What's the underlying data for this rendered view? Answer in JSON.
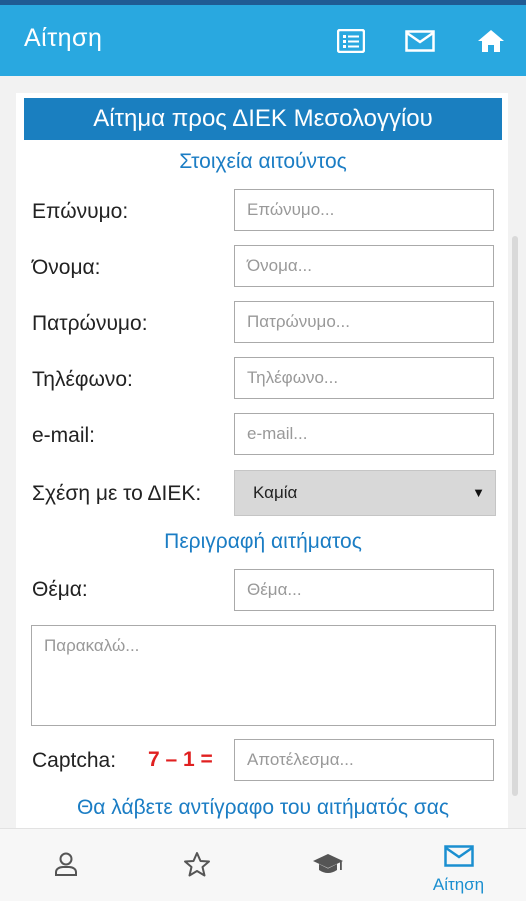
{
  "appbar": {
    "title": "Αίτηση",
    "icons": [
      "list-icon",
      "mail-icon",
      "home-icon"
    ]
  },
  "form": {
    "title": "Αίτημα προς ΔΙΕΚ Μεσολογγίου",
    "applicant_section": "Στοιχεία αιτούντος",
    "fields": [
      {
        "label": "Επώνυμο:",
        "placeholder": "Επώνυμο..."
      },
      {
        "label": "Όνομα:",
        "placeholder": "Όνομα..."
      },
      {
        "label": "Πατρώνυμο:",
        "placeholder": "Πατρώνυμο..."
      },
      {
        "label": "Τηλέφωνο:",
        "placeholder": "Τηλέφωνο..."
      },
      {
        "label": "e-mail:",
        "placeholder": "e-mail..."
      }
    ],
    "relation": {
      "label": "Σχέση με το ΔΙΕΚ:",
      "selected": "Καμία"
    },
    "request_section": "Περιγραφή αιτήματος",
    "subject": {
      "label": "Θέμα:",
      "placeholder": "Θέμα..."
    },
    "message_placeholder": "Παρακαλώ...",
    "captcha": {
      "label": "Captcha:",
      "equation": "7 – 1 =",
      "placeholder": "Αποτέλεσμα..."
    },
    "copy_note": "Θα λάβετε αντίγραφο του αιτήματός σας"
  },
  "bottom_nav": [
    {
      "icon": "person-icon",
      "label": ""
    },
    {
      "icon": "star-icon",
      "label": ""
    },
    {
      "icon": "graduation-cap-icon",
      "label": ""
    },
    {
      "icon": "mail-icon",
      "label": "Αίτηση",
      "active": true
    }
  ],
  "colors": {
    "appbar": "#29a8e0",
    "form_title_bg": "#1a7fc0",
    "section_text": "#1b7dc4",
    "captcha_text": "#e02020"
  }
}
